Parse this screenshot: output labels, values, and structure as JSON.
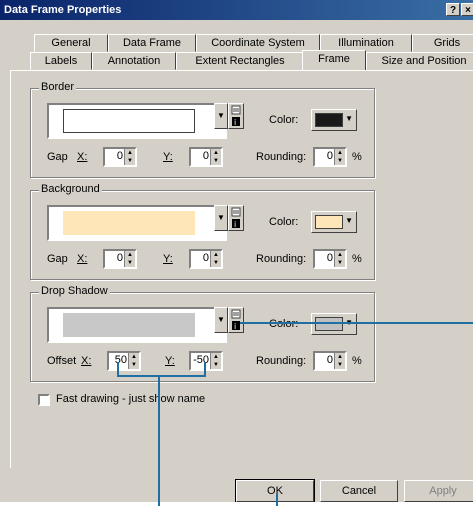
{
  "window": {
    "title": "Data Frame Properties",
    "help_glyph": "?",
    "close_glyph": "×"
  },
  "tabs_row1": [
    "General",
    "Data Frame",
    "Coordinate System",
    "Illumination",
    "Grids"
  ],
  "tabs_row2": [
    "Labels",
    "Annotation",
    "Extent Rectangles",
    "Frame",
    "Size and Position"
  ],
  "active_tab": "Frame",
  "border": {
    "group_label": "Border",
    "color_label": "Color:",
    "color_value": "#1a1a1a",
    "symbol_fill": "#ffffff",
    "gap_label": "Gap",
    "x_label": "X:",
    "x_value": "0",
    "y_label": "Y:",
    "y_value": "0",
    "rounding_label": "Rounding:",
    "rounding_value": "0",
    "percent": "%"
  },
  "background": {
    "group_label": "Background",
    "color_label": "Color:",
    "color_value": "#ffe6b8",
    "symbol_fill": "#ffe6b8",
    "gap_label": "Gap",
    "x_label": "X:",
    "x_value": "0",
    "y_label": "Y:",
    "y_value": "0",
    "rounding_label": "Rounding:",
    "rounding_value": "0",
    "percent": "%"
  },
  "shadow": {
    "group_label": "Drop Shadow",
    "color_label": "Color:",
    "color_value": "#c0c0c0",
    "symbol_fill": "#c8c8c8",
    "offset_label": "Offset",
    "x_label": "X:",
    "x_value": "50",
    "y_label": "Y:",
    "y_value": "-50",
    "rounding_label": "Rounding:",
    "rounding_value": "0",
    "percent": "%"
  },
  "fast_drawing": {
    "label": "Fast drawing - just show name",
    "checked": false
  },
  "buttons": {
    "ok": "OK",
    "cancel": "Cancel",
    "apply": "Apply"
  },
  "callout_color": "#1f6fa3"
}
